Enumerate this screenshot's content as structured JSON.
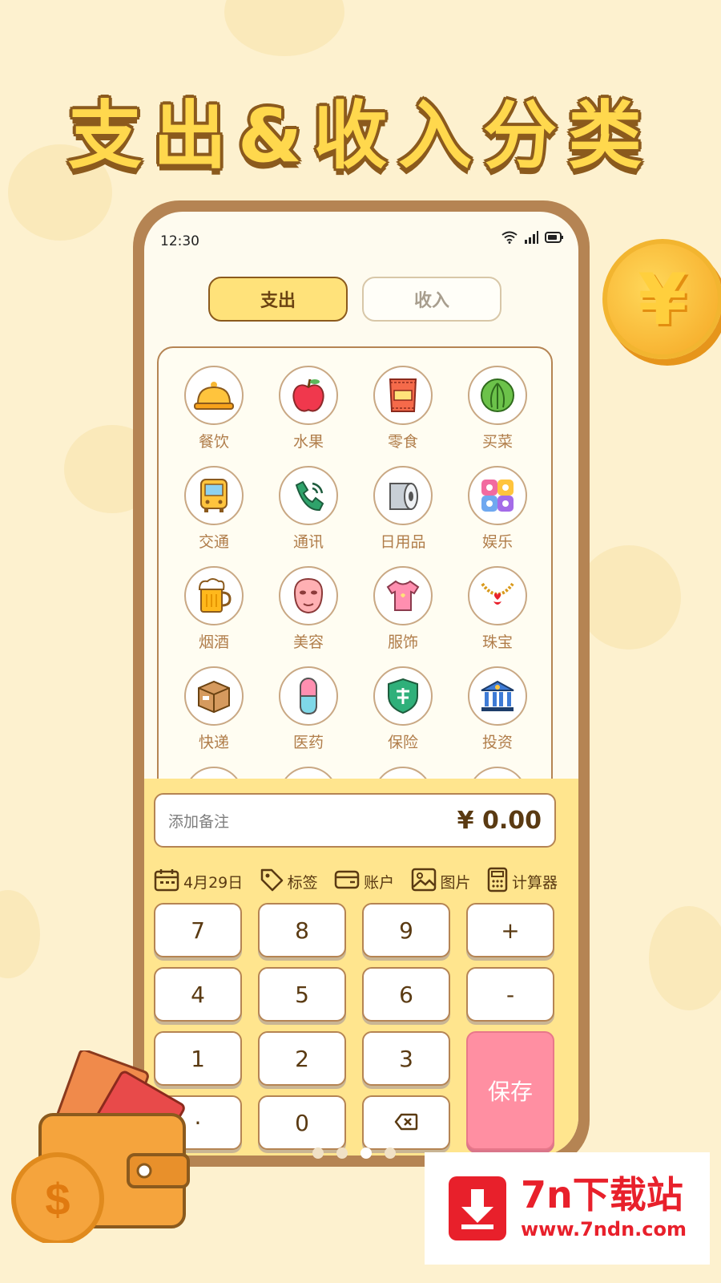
{
  "headline": "支出&收入分类",
  "status_bar": {
    "time": "12:30"
  },
  "tabs": [
    {
      "label": "支出",
      "active": true
    },
    {
      "label": "收入",
      "active": false
    }
  ],
  "categories": [
    {
      "label": "餐饮",
      "icon": "food-cloche-icon"
    },
    {
      "label": "水果",
      "icon": "apple-icon"
    },
    {
      "label": "零食",
      "icon": "snack-bag-icon"
    },
    {
      "label": "买菜",
      "icon": "cabbage-icon"
    },
    {
      "label": "交通",
      "icon": "bus-icon"
    },
    {
      "label": "通讯",
      "icon": "phone-icon"
    },
    {
      "label": "日用品",
      "icon": "tissue-roll-icon"
    },
    {
      "label": "娱乐",
      "icon": "entertainment-icon"
    },
    {
      "label": "烟酒",
      "icon": "beer-icon"
    },
    {
      "label": "美容",
      "icon": "face-mask-icon"
    },
    {
      "label": "服饰",
      "icon": "tshirt-icon"
    },
    {
      "label": "珠宝",
      "icon": "necklace-icon"
    },
    {
      "label": "快递",
      "icon": "parcel-icon"
    },
    {
      "label": "医药",
      "icon": "pill-icon"
    },
    {
      "label": "保险",
      "icon": "shield-icon"
    },
    {
      "label": "投资",
      "icon": "bank-icon"
    }
  ],
  "entry": {
    "note_placeholder": "添加备注",
    "amount": "¥ 0.00"
  },
  "tools": {
    "date": "4月29日",
    "tag": "标签",
    "account": "账户",
    "image": "图片",
    "calculator": "计算器"
  },
  "keypad": {
    "k7": "7",
    "k8": "8",
    "k9": "9",
    "plus": "+",
    "k4": "4",
    "k5": "5",
    "k6": "6",
    "minus": "-",
    "k1": "1",
    "k2": "2",
    "k3": "3",
    "dot": "·",
    "k0": "0",
    "save": "保存"
  },
  "decor": {
    "coin_symbol": "¥"
  },
  "watermark": {
    "title": "7n下载站",
    "url": "www.7ndn.com"
  },
  "colors": {
    "background": "#fdf1cf",
    "accent_yellow": "#ffe27a",
    "brown": "#b58453",
    "save_pink": "#ff8fa2",
    "label_brown": "#b07d4a"
  }
}
